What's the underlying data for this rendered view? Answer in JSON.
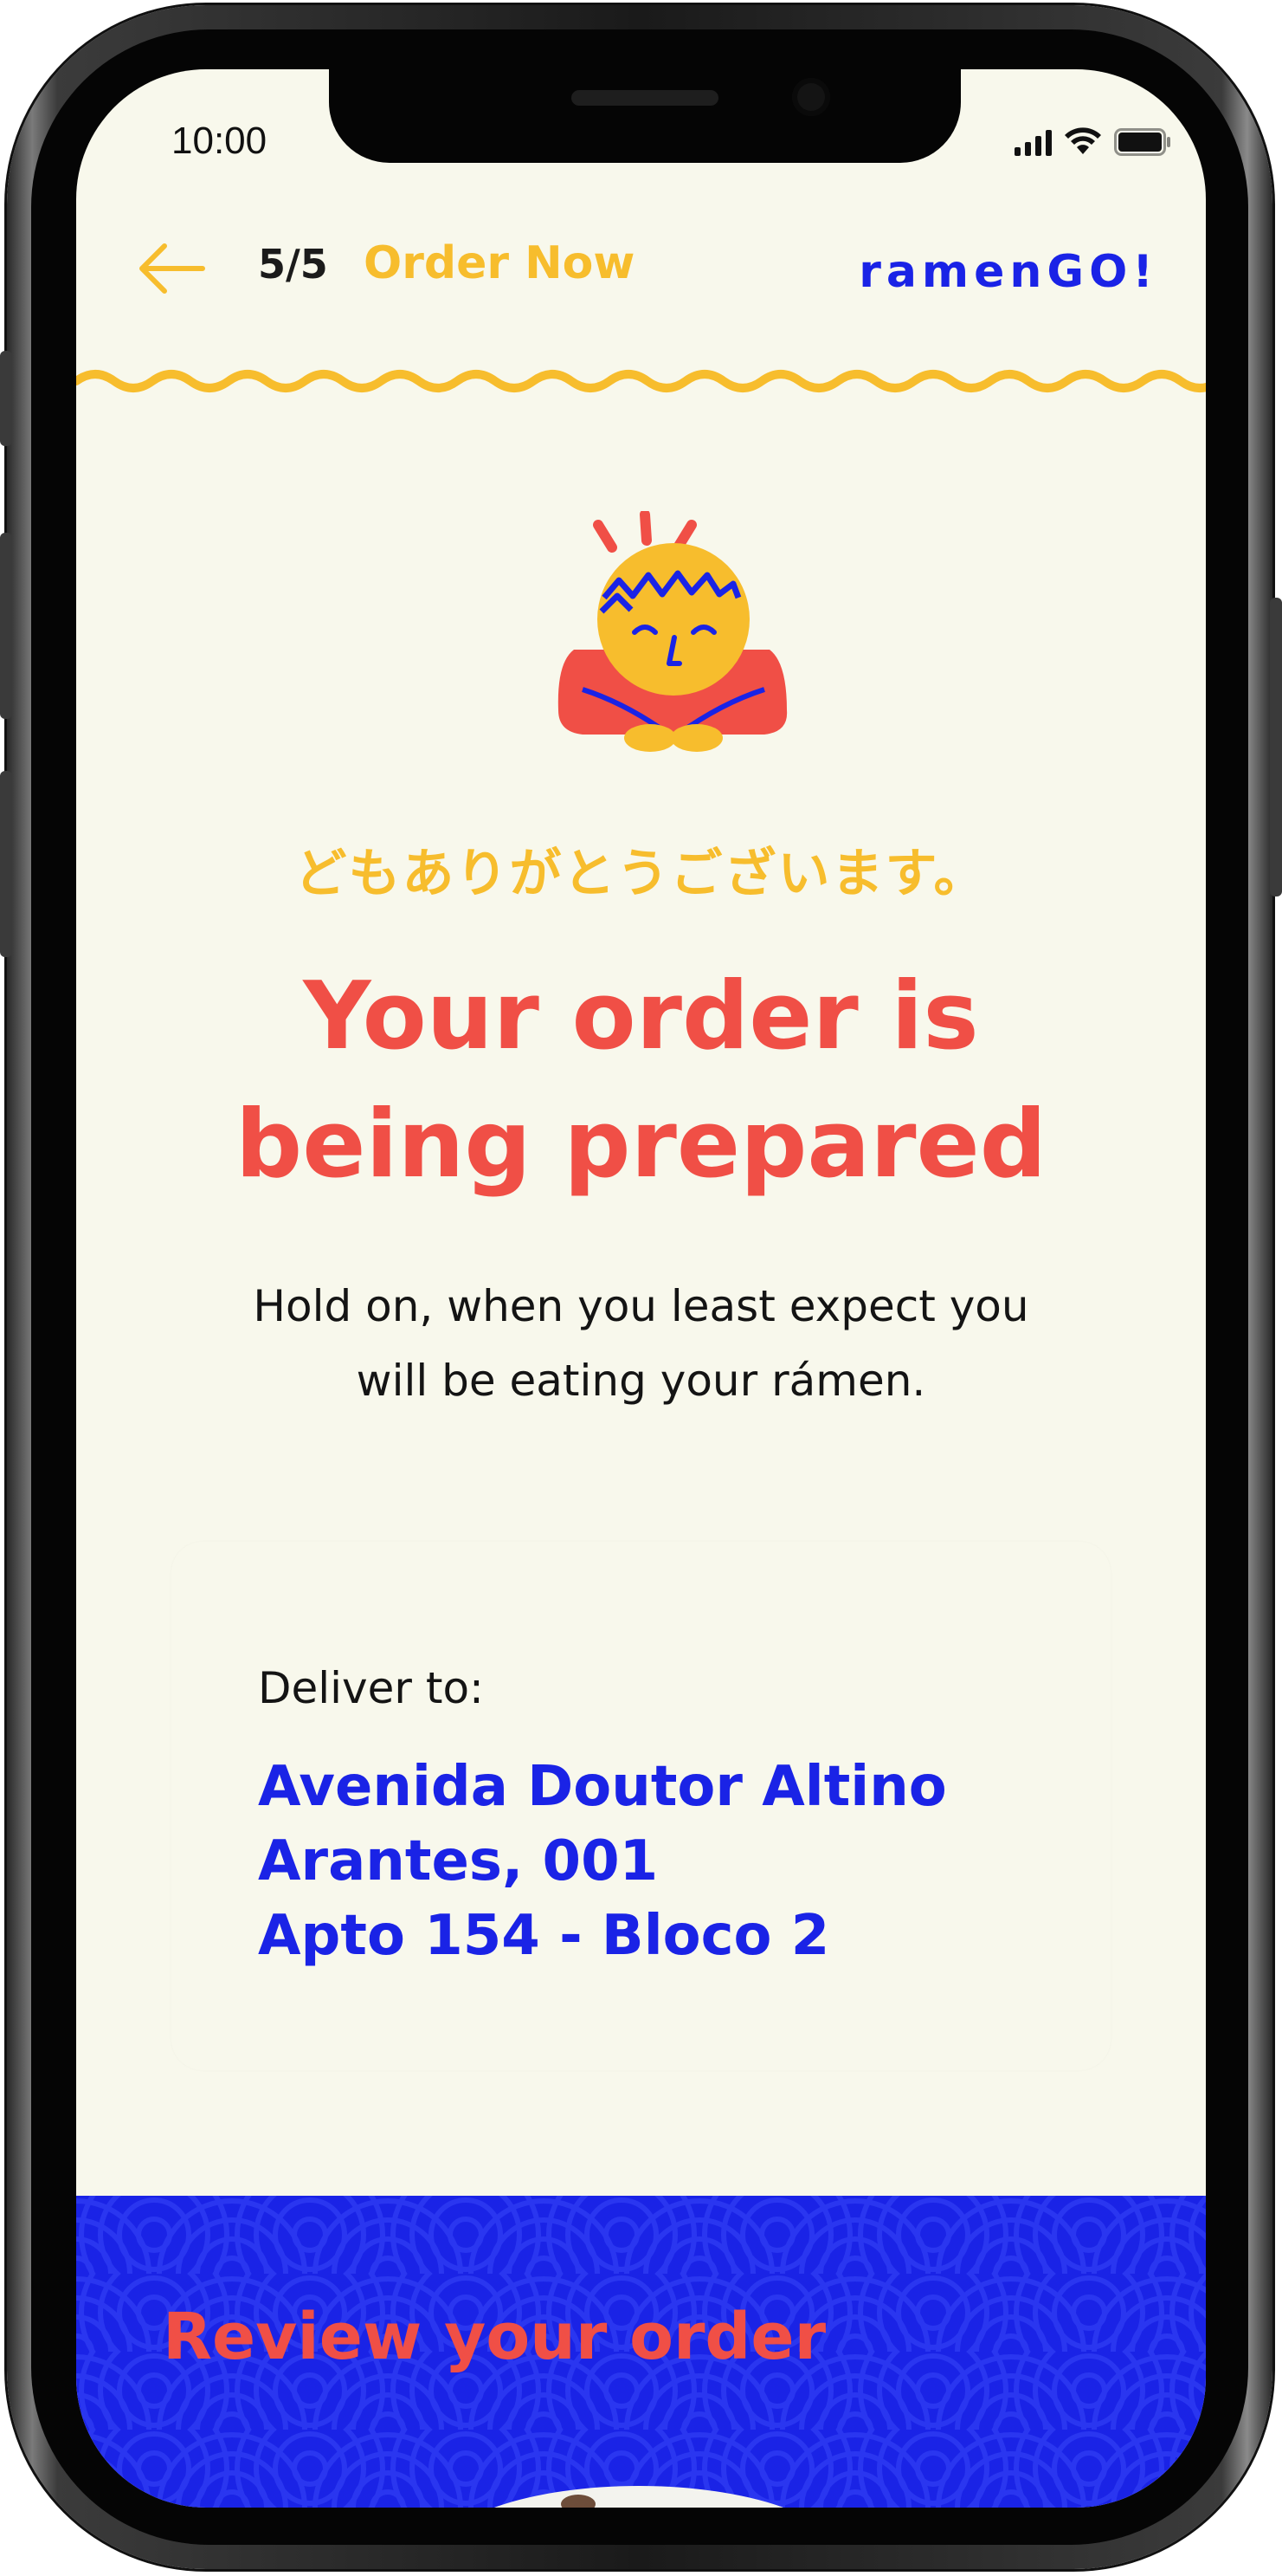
{
  "status_bar": {
    "time": "10:00",
    "icons": [
      "signal-icon",
      "wifi-icon",
      "battery-icon"
    ]
  },
  "header": {
    "back_icon": "arrow-left-icon",
    "step": "5/5",
    "title": "Order Now",
    "brand": "ramenGO!"
  },
  "confirmation": {
    "mascot_icon": "bowing-mascot-icon",
    "thanks_jp": "どもありがとうございます。",
    "title_line1": "Your order is",
    "title_line2": "being prepared",
    "subtitle_line1": "Hold on, when you least expect you",
    "subtitle_line2": "will be eating your rámen."
  },
  "delivery": {
    "label": "Deliver to:",
    "address_line1": "Avenida Doutor Altino",
    "address_line2": "Arantes, 001",
    "address_line3": "Apto 154 - Bloco 2"
  },
  "review": {
    "title": "Review your order"
  },
  "colors": {
    "background": "#f8f8ec",
    "yellow": "#f7bd2d",
    "red": "#f04f46",
    "blue": "#1a23e6",
    "text": "#141414"
  }
}
